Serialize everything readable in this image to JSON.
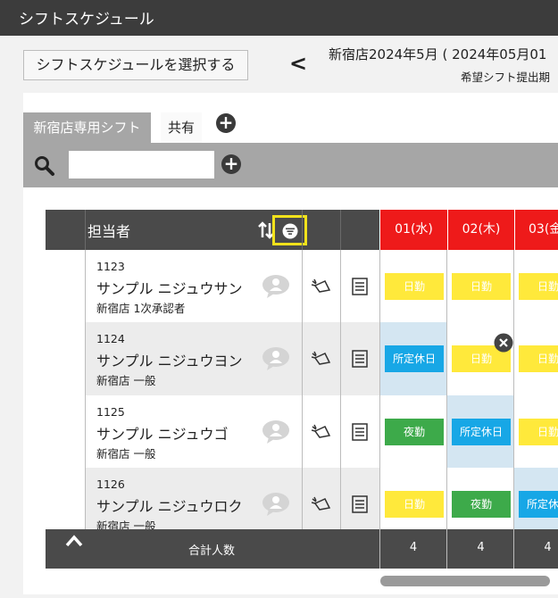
{
  "app": {
    "title": "シフトスケジュール"
  },
  "toolbar": {
    "select_schedule_label": "シフトスケジュールを選択する",
    "prev_label": "<",
    "period_title": "新宿店2024年5月 ( 2024年05月01",
    "deadline_label": "希望シフト提出期"
  },
  "tabs": [
    {
      "label": "新宿店専用シフト",
      "active": true
    },
    {
      "label": "共有",
      "active": false
    }
  ],
  "add_tab_label": "+",
  "search": {
    "value": "",
    "add_label": "+"
  },
  "table": {
    "staff_header": "担当者",
    "dates": [
      {
        "label": "01(水)"
      },
      {
        "label": "02(木)"
      },
      {
        "label": "03(金"
      }
    ],
    "employees": [
      {
        "id": "1123",
        "name": "サンプル ニジュウサン",
        "dept": "新宿店 1次承認者",
        "shifts": [
          {
            "label": "日勤",
            "type": "day"
          },
          {
            "label": "日勤",
            "type": "day"
          },
          {
            "label": "日勤",
            "type": "day"
          }
        ]
      },
      {
        "id": "1124",
        "name": "サンプル ニジュウヨン",
        "dept": "新宿店 一般",
        "shifts": [
          {
            "label": "所定休日",
            "type": "off"
          },
          {
            "label": "日勤",
            "type": "day"
          },
          {
            "label": "日勤",
            "type": "day"
          }
        ]
      },
      {
        "id": "1125",
        "name": "サンプル ニジュウゴ",
        "dept": "新宿店 一般",
        "shifts": [
          {
            "label": "夜勤",
            "type": "night"
          },
          {
            "label": "所定休日",
            "type": "off"
          },
          {
            "label": "日勤",
            "type": "day"
          }
        ]
      },
      {
        "id": "1126",
        "name": "サンプル ニジュウロク",
        "dept": "新宿店 一般",
        "shifts": [
          {
            "label": "日勤",
            "type": "day"
          },
          {
            "label": "夜勤",
            "type": "night"
          },
          {
            "label": "所定休日",
            "type": "off"
          }
        ]
      }
    ],
    "footer_label": "合計人数",
    "totals": [
      "4",
      "4",
      "4"
    ]
  },
  "colors": {
    "day": "#ffe93b",
    "off": "#17a7e6",
    "night": "#3daa4a",
    "header_red": "#ee1a1a",
    "highlight": "#f2e21b"
  }
}
